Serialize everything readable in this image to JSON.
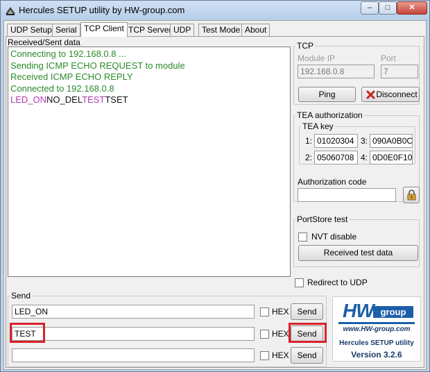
{
  "window": {
    "title": "Hercules SETUP utility by HW-group.com",
    "controls": {
      "minimize": "–",
      "maximize": "□",
      "close": "✕"
    }
  },
  "tabs": [
    {
      "label": "UDP Setup"
    },
    {
      "label": "Serial"
    },
    {
      "label": "TCP Client",
      "active": true
    },
    {
      "label": "TCP Server"
    },
    {
      "label": "UDP"
    },
    {
      "label": "Test Mode"
    },
    {
      "label": "About"
    }
  ],
  "received": {
    "label": "Received/Sent data",
    "lines": [
      {
        "segments": [
          {
            "text": "Connecting to 192.168.0.8 ...",
            "color": "green"
          }
        ]
      },
      {
        "segments": [
          {
            "text": "Sending ICMP ECHO REQUEST to module",
            "color": "green"
          }
        ]
      },
      {
        "segments": [
          {
            "text": "Received ICMP ECHO REPLY",
            "color": "green"
          }
        ]
      },
      {
        "segments": [
          {
            "text": "Connected to 192.168.0.8",
            "color": "green"
          }
        ]
      },
      {
        "segments": [
          {
            "text": "LED_ON",
            "color": "purple"
          },
          {
            "text": "NO_DEL",
            "color": "black"
          },
          {
            "text": "TEST",
            "color": "purple"
          },
          {
            "text": "TSET",
            "color": "black"
          }
        ]
      }
    ]
  },
  "tcp": {
    "group_label": "TCP",
    "module_ip_label": "Module IP",
    "module_ip_value": "192.168.0.8",
    "port_label": "Port",
    "port_value": "7",
    "ping_label": "Ping",
    "disconnect_label": "Disconnect"
  },
  "tea": {
    "group_label": "TEA authorization",
    "key_label": "TEA key",
    "keys": [
      {
        "index": "1:",
        "value": "01020304"
      },
      {
        "index": "3:",
        "value": "090A0B0C"
      },
      {
        "index": "2:",
        "value": "05060708"
      },
      {
        "index": "4:",
        "value": "0D0E0F10"
      }
    ],
    "auth_code_label": "Authorization code",
    "auth_code_value": ""
  },
  "portstore": {
    "group_label": "PortStore test",
    "nvt_label": "NVT disable",
    "nvt_checked": false,
    "received_button": "Received test data"
  },
  "redirect": {
    "label": "Redirect to UDP",
    "checked": false
  },
  "send": {
    "group_label": "Send",
    "rows": [
      {
        "value": "LED_ON",
        "hex_label": "HEX",
        "hex_checked": false,
        "button": "Send",
        "highlighted": false
      },
      {
        "value": "TEST",
        "hex_label": "HEX",
        "hex_checked": false,
        "button": "Send",
        "highlighted": true
      },
      {
        "value": "",
        "hex_label": "HEX",
        "hex_checked": false,
        "button": "Send",
        "highlighted": false
      }
    ]
  },
  "logo": {
    "brand": "HW",
    "group": "group",
    "url": "www.HW-group.com",
    "app_name": "Hercules SETUP utility",
    "version": "Version  3.2.6"
  },
  "colors": {
    "highlight": "#d6232a",
    "console_green": "#2a8a2a",
    "console_purple": "#b03ab0",
    "brand_blue": "#1c5fa8"
  }
}
